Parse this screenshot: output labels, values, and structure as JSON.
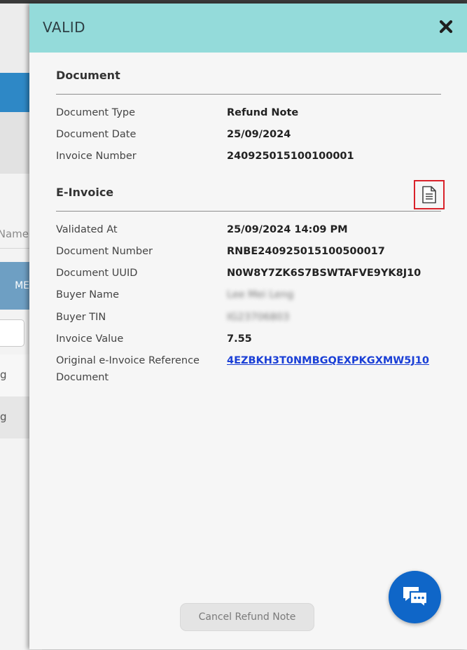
{
  "background": {
    "column_header": "Name",
    "highlight_text": "ME",
    "row1_text": "g",
    "row2_text": "g"
  },
  "panel": {
    "title": "VALID",
    "document_section": {
      "title": "Document",
      "fields": [
        {
          "label": "Document Type",
          "value": "Refund Note"
        },
        {
          "label": "Document Date",
          "value": "25/09/2024"
        },
        {
          "label": "Invoice Number",
          "value": "240925015100100001"
        }
      ]
    },
    "einvoice_section": {
      "title": "E-Invoice",
      "fields": [
        {
          "label": "Validated At",
          "value": "25/09/2024 14:09 PM"
        },
        {
          "label": "Document Number",
          "value": "RNBE240925015100500017"
        },
        {
          "label": "Document UUID",
          "value": "N0W8Y7ZK6S7BSWTAFVE9YK8J10"
        },
        {
          "label": "Buyer Name",
          "value": "Lee Mei Leng"
        },
        {
          "label": "Buyer TIN",
          "value": "IG23706803"
        },
        {
          "label": "Invoice Value",
          "value": "7.55"
        },
        {
          "label": "Original e-Invoice Reference Document",
          "value": "4EZBKH3T0NMBGQEXPKGXMW5J10"
        }
      ]
    },
    "cancel_label": "Cancel Refund Note"
  },
  "colors": {
    "header_bg": "#94dbda",
    "link": "#1a3fd6",
    "chat_button": "#0f66c8",
    "highlight_border": "#d9222a"
  },
  "icons": {
    "close": "close-icon",
    "document": "document-icon",
    "chat": "chat-icon"
  }
}
